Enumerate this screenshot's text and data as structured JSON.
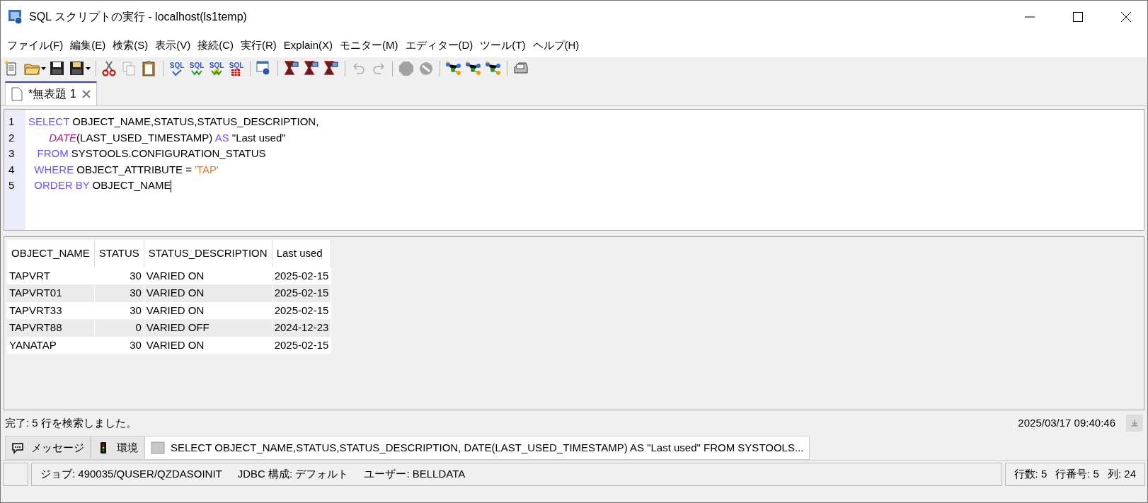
{
  "window": {
    "title": "SQL スクリプトの実行 - localhost(ls1temp)"
  },
  "menu": [
    "ファイル(F)",
    "編集(E)",
    "検索(S)",
    "表示(V)",
    "接続(C)",
    "実行(R)",
    "Explain(X)",
    "モニター(M)",
    "エディター(D)",
    "ツール(T)",
    "ヘルプ(H)"
  ],
  "toolbar": [
    {
      "kind": "new",
      "disabled": false
    },
    {
      "kind": "open",
      "disabled": false,
      "dropdown": true
    },
    {
      "kind": "save",
      "disabled": false
    },
    {
      "kind": "saveall",
      "disabled": false,
      "dropdown": true
    },
    {
      "kind": "sep"
    },
    {
      "kind": "cut",
      "disabled": false
    },
    {
      "kind": "copy",
      "disabled": true
    },
    {
      "kind": "paste",
      "disabled": false
    },
    {
      "kind": "sep"
    },
    {
      "kind": "sqlcheck",
      "label": "SQL",
      "disabled": false
    },
    {
      "kind": "sqlrun",
      "label": "SQL",
      "disabled": false
    },
    {
      "kind": "sqlrunall",
      "label": "SQL",
      "disabled": false
    },
    {
      "kind": "sqlgrid",
      "label": "SQL",
      "disabled": false
    },
    {
      "kind": "sep"
    },
    {
      "kind": "settings",
      "disabled": false
    },
    {
      "kind": "sep"
    },
    {
      "kind": "explain",
      "disabled": false
    },
    {
      "kind": "explain",
      "disabled": false
    },
    {
      "kind": "explain",
      "disabled": false
    },
    {
      "kind": "sep"
    },
    {
      "kind": "undo",
      "disabled": true
    },
    {
      "kind": "redo",
      "disabled": true
    },
    {
      "kind": "sep"
    },
    {
      "kind": "stop",
      "disabled": true
    },
    {
      "kind": "cancel",
      "disabled": true
    },
    {
      "kind": "sep"
    },
    {
      "kind": "graph",
      "disabled": false
    },
    {
      "kind": "graph",
      "disabled": false
    },
    {
      "kind": "graph",
      "disabled": false
    },
    {
      "kind": "sep"
    },
    {
      "kind": "print",
      "disabled": false
    }
  ],
  "editor_tabs": [
    {
      "label": "*無表題 1",
      "selected": true
    }
  ],
  "editor": {
    "lines": [
      {
        "number": "1",
        "tokens": [
          {
            "kind": "keyword",
            "text": "SELECT "
          },
          {
            "kind": "plain",
            "text": "OBJECT_NAME,STATUS,STATUS_DESCRIPTION,"
          }
        ]
      },
      {
        "number": "2",
        "tokens": [
          {
            "kind": "function",
            "text": "       DATE"
          },
          {
            "kind": "plain",
            "text": "(LAST_USED_TIMESTAMP) "
          },
          {
            "kind": "keyword",
            "text": "AS"
          },
          {
            "kind": "plain",
            "text": " \"Last used\""
          }
        ]
      },
      {
        "number": "3",
        "tokens": [
          {
            "kind": "keyword",
            "text": "   FROM "
          },
          {
            "kind": "plain",
            "text": "SYSTOOLS.CONFIGURATION_STATUS"
          }
        ]
      },
      {
        "number": "4",
        "tokens": [
          {
            "kind": "keyword",
            "text": "  WHERE "
          },
          {
            "kind": "plain",
            "text": "OBJECT_ATTRIBUTE = "
          },
          {
            "kind": "string",
            "text": "'TAP'"
          }
        ]
      },
      {
        "number": "5",
        "tokens": [
          {
            "kind": "keyword",
            "text": "  ORDER BY "
          },
          {
            "kind": "plain",
            "text": "OBJECT_NAME"
          }
        ]
      }
    ]
  },
  "table": {
    "columns": [
      {
        "label": "OBJECT_NAME"
      },
      {
        "label": "STATUS"
      },
      {
        "label": "STATUS_DESCRIPTION"
      },
      {
        "label": "Last used"
      }
    ],
    "rows": [
      [
        "TAPVRT",
        "30",
        "VARIED ON",
        "2025-02-15"
      ],
      [
        "TAPVRT01",
        "30",
        "VARIED ON",
        "2025-02-15"
      ],
      [
        "TAPVRT33",
        "30",
        "VARIED ON",
        "2025-02-15"
      ],
      [
        "TAPVRT88",
        "0",
        "VARIED OFF",
        "2024-12-23"
      ],
      [
        "YANATAP",
        "30",
        "VARIED ON",
        "2025-02-15"
      ]
    ]
  },
  "message": {
    "text": "完了: 5 行を検索しました。",
    "timestamp": "2025/03/17 09:40:46"
  },
  "bottom_tabs": [
    {
      "kind": "message",
      "label": "メッセージ",
      "selected": false
    },
    {
      "kind": "environment",
      "label": "環境",
      "selected": false
    },
    {
      "kind": "sql",
      "label": "SELECT OBJECT_NAME,STATUS,STATUS_DESCRIPTION, DATE(LAST_USED_TIMESTAMP) AS \"Last used\" FROM SYSTOOLS...",
      "selected": true
    }
  ],
  "status_bar": {
    "job": [
      "ジョブ: 490035/QUSER/QZDASOINIT",
      "JDBC 構成: デフォルト",
      "ユーザー: BELLDATA"
    ],
    "position": [
      "行数: 5",
      "行番号: 5",
      "列: 24"
    ]
  }
}
